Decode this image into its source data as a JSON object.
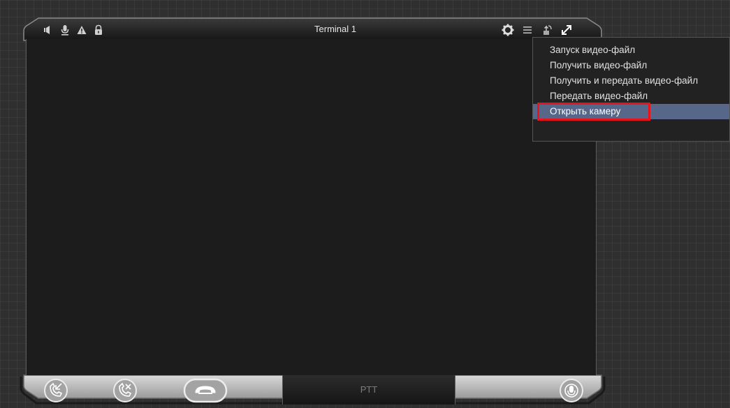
{
  "window": {
    "title": "Terminal 1"
  },
  "top_icons_left": [
    "speaker-icon",
    "microphone-icon",
    "warning-icon",
    "lock-icon"
  ],
  "top_icons_right": [
    "settings-icon",
    "menu-icon",
    "upload-icon",
    "expand-icon"
  ],
  "menu": {
    "items": [
      {
        "label": "Запуск видео-файл"
      },
      {
        "label": "Получить видео-файл"
      },
      {
        "label": "Получить и передать видео-файл"
      },
      {
        "label": "Передать видео-файл"
      },
      {
        "label": "Открыть камеру",
        "active": true
      }
    ]
  },
  "bottom_bar": {
    "buttons": [
      "call-answer-icon",
      "call-reject-icon",
      "hang-up-icon",
      "microphone-toggle-icon"
    ],
    "ptt_label": "PTT"
  },
  "colors": {
    "menu_highlight": "#56678a",
    "annotation_border": "#e8141b",
    "frame_dark": "#111111",
    "frame_silver": "#c9c9c9"
  }
}
